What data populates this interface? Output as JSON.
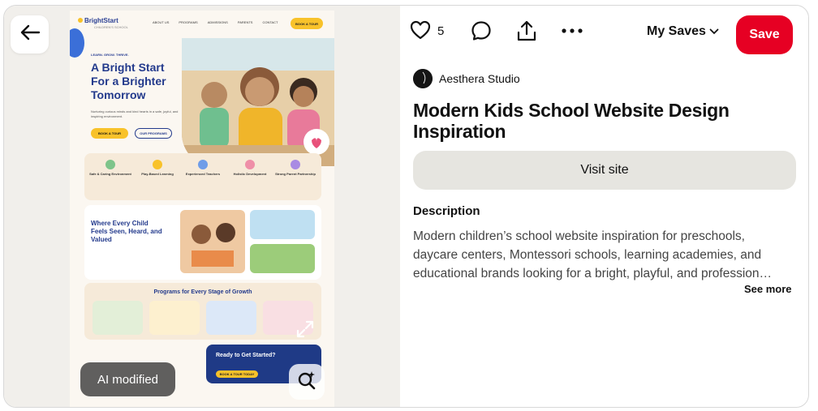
{
  "pin": {
    "ai_badge": "AI modified",
    "mock_site": {
      "logo": "BrightStart",
      "logo_sub": "CHILDREN'S SCHOOL",
      "nav_links": [
        "ABOUT US",
        "PROGRAMS",
        "ADMISSIONS",
        "PARENTS",
        "CONTACT"
      ],
      "nav_button": "BOOK A TOUR",
      "tagline": "LEARN. GROW. THRIVE.",
      "hero_title": "A Bright Start For a Brighter Tomorrow",
      "hero_text": "Nurturing curious minds and kind hearts in a safe, joyful, and inspiring environment.",
      "hero_btn_primary": "BOOK A TOUR",
      "hero_btn_secondary": "OUR PROGRAMS",
      "features": [
        "Safe & Caring Environment",
        "Play-Based Learning",
        "Experienced Teachers",
        "Holistic Development",
        "Strong Parent Partnership"
      ],
      "welcome_title": "Where Every Child Feels Seen, Heard, and Valued",
      "programs_title": "Programs for Every Stage of Growth",
      "cta_title": "Ready to Get Started?",
      "cta_button": "BOOK A TOUR TODAY"
    }
  },
  "actions": {
    "like_count": "5",
    "board_select": "My Saves",
    "save_label": "Save"
  },
  "creator": {
    "name": "Aesthera Studio"
  },
  "title": "Modern Kids School Website Design Inspiration",
  "visit_label": "Visit site",
  "description": {
    "heading": "Description",
    "line1": "Modern children’s school website inspiration for preschools,",
    "line2": "daycare centers, Montessori schools, learning academies, and",
    "line3": "educational brands looking for a bright, playful, and profession…",
    "see_more": "See more"
  },
  "colors": {
    "save_red": "#e60023",
    "visit_bg": "#e6e5e0",
    "left_bg": "#f1efeb"
  }
}
